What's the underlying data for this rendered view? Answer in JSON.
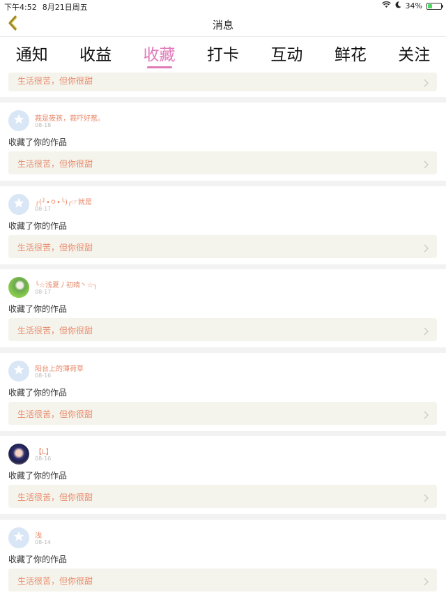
{
  "status_bar": {
    "time": "下午4:52",
    "date": "8月21日周五",
    "battery": "34%",
    "battery_level": 0.34,
    "icons": [
      "wifi-icon",
      "moon-icon",
      "battery-icon"
    ]
  },
  "nav": {
    "title": "消息",
    "back_icon": "chevron-left-icon"
  },
  "tabs": [
    {
      "label": "通知",
      "active": false
    },
    {
      "label": "收益",
      "active": false
    },
    {
      "label": "收藏",
      "active": true
    },
    {
      "label": "打卡",
      "active": false
    },
    {
      "label": "互动",
      "active": false
    },
    {
      "label": "鲜花",
      "active": false
    },
    {
      "label": "关注",
      "active": false
    }
  ],
  "partial_item": {
    "work_title": "生活很苦，但你很甜"
  },
  "items": [
    {
      "avatar": "default",
      "user": "莪是筱孩，莪吓好惹。",
      "time": "08-18",
      "action": "收藏了你的作品",
      "work_title": "生活很苦，但你很甜"
    },
    {
      "avatar": "default",
      "user": "╭(╯•ㅇ•╰)╭☞就是",
      "time": "08-17",
      "action": "收藏了你的作品",
      "work_title": "生活很苦，但你很甜"
    },
    {
      "avatar": "photo1",
      "user": "╰☆浅夏丿初晴丶☆╮",
      "time": "08-17",
      "action": "收藏了你的作品",
      "work_title": "生活很苦，但你很甜"
    },
    {
      "avatar": "default",
      "user": "阳台上的薄荷草",
      "time": "08-16",
      "action": "收藏了你的作品",
      "work_title": "生活很苦，但你很甜"
    },
    {
      "avatar": "photo2",
      "user": "【L】",
      "time": "08-16",
      "action": "收藏了你的作品",
      "work_title": "生活很苦，但你很甜"
    },
    {
      "avatar": "default",
      "user": "浅",
      "time": "08-14",
      "action": "收藏了你的作品",
      "work_title": "生活很苦，但你很甜"
    }
  ],
  "colors": {
    "accent": "#e07bb9",
    "name_text": "#e8896a",
    "work_bg": "#f5f4ec",
    "avatar_default_bg": "#d9e6f6",
    "separator": "#f2f2f2"
  }
}
